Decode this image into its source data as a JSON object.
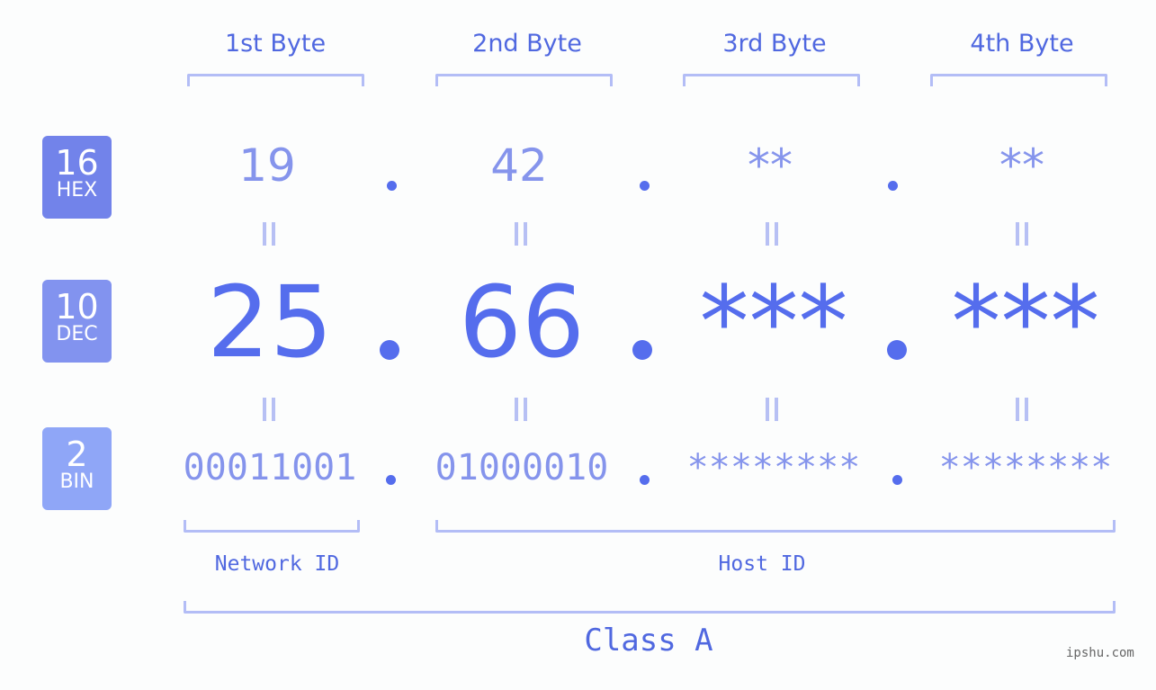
{
  "byte_headers": [
    "1st Byte",
    "2nd Byte",
    "3rd Byte",
    "4th Byte"
  ],
  "badges": [
    {
      "num": "16",
      "label": "HEX",
      "color": "#7283ea"
    },
    {
      "num": "10",
      "label": "DEC",
      "color": "#8293ef"
    },
    {
      "num": "2",
      "label": "BIN",
      "color": "#8fa6f7"
    }
  ],
  "hex": [
    "19",
    "42",
    "**",
    "**"
  ],
  "dec": [
    "25",
    "66",
    "***",
    "***"
  ],
  "bin": [
    "00011001",
    "01000010",
    "********",
    "********"
  ],
  "labels": {
    "network_id": "Network ID",
    "host_id": "Host ID",
    "class": "Class A"
  },
  "watermark": "ipshu.com",
  "colors": {
    "accent": "#556ded",
    "header_text": "#5068e0",
    "light_value": "#8594ec",
    "bracket": "#b3bdf6"
  }
}
